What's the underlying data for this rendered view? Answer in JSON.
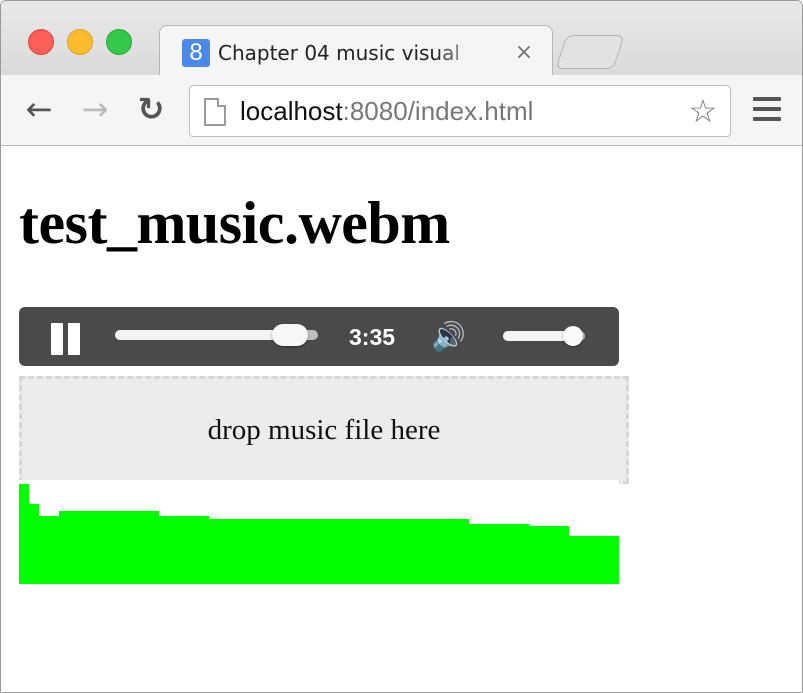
{
  "browser": {
    "tab": {
      "favicon_letter": "8",
      "title": "Chapter 04 music visual",
      "close_glyph": "×"
    },
    "toolbar": {
      "back_icon": "arrow-left-icon",
      "forward_icon": "arrow-right-icon",
      "reload_icon": "reload-icon",
      "url_host": "localhost",
      "url_rest": ":8080/index.html",
      "bookmark_icon": "star-icon",
      "menu_icon": "hamburger-menu-icon"
    }
  },
  "page": {
    "heading": "test_music.webm",
    "player": {
      "state": "playing",
      "time": "3:35",
      "progress": 0.86,
      "volume": 0.85
    },
    "dropzone_text": "drop music file here",
    "visualizer": {
      "color": "#00ff00",
      "max_level": 100,
      "levels": [
        100,
        80,
        68,
        68,
        73,
        73,
        73,
        73,
        73,
        73,
        73,
        73,
        73,
        73,
        68,
        68,
        68,
        68,
        68,
        65,
        65,
        65,
        65,
        65,
        65,
        65,
        65,
        65,
        65,
        65,
        65,
        65,
        65,
        65,
        65,
        65,
        65,
        65,
        65,
        65,
        65,
        65,
        65,
        65,
        65,
        60,
        60,
        60,
        60,
        60,
        60,
        58,
        58,
        58,
        58,
        48,
        48,
        48,
        48,
        48
      ]
    }
  }
}
